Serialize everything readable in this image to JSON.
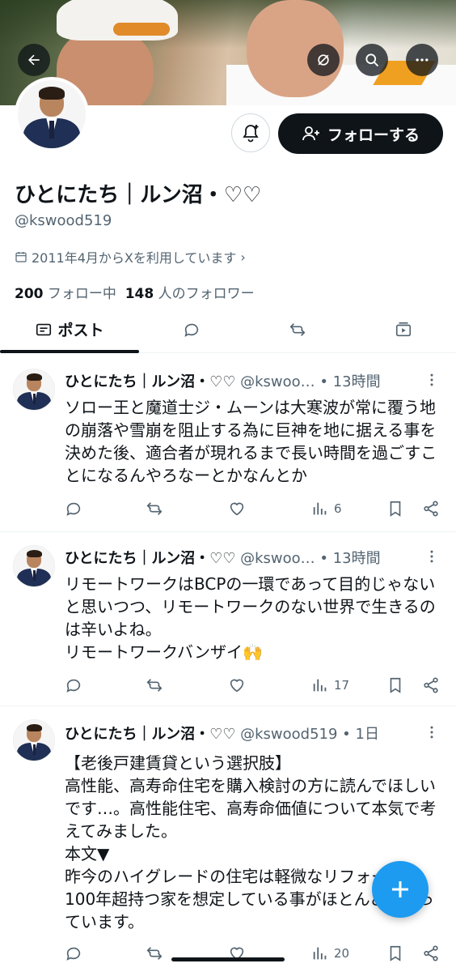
{
  "profile": {
    "name": "ひとにたち｜ルン沼・♡♡",
    "handle": "@kswood519",
    "joined": "2011年4月からXを利用しています",
    "following_count": "200",
    "following_label": "フォロー中",
    "followers_count": "148",
    "followers_label": "人のフォロワー",
    "follow_button": "フォローする"
  },
  "tabs": [
    {
      "label": "ポスト",
      "icon": "posts-icon",
      "active": true
    },
    {
      "label": "",
      "icon": "reply-icon",
      "active": false
    },
    {
      "label": "",
      "icon": "repost-icon",
      "active": false
    },
    {
      "label": "",
      "icon": "media-icon",
      "active": false
    }
  ],
  "posts": [
    {
      "author": "ひとにたち｜ルン沼・♡♡",
      "meta": "@kswoo… • 13時間",
      "text": "ソロー王と魔道士ジ・ムーンは大寒波が常に覆う地の崩落や雪崩を阻止する為に巨神を地に据える事を決めた後、適合者が現れるまで長い時間を過ごすことになるんやろなーとかなんとか",
      "views": "6"
    },
    {
      "author": "ひとにたち｜ルン沼・♡♡",
      "meta": "@kswoo… • 13時間",
      "text": "リモートワークはBCPの一環であって目的じゃないと思いつつ、リモートワークのない世界で生きるのは辛いよね。\nリモートワークバンザイ🙌",
      "views": "17"
    },
    {
      "author": "ひとにたち｜ルン沼・♡♡",
      "meta": "@kswood519 • 1日",
      "text": "【老後戸建賃貸という選択肢】\n高性能、高寿命住宅を購入検討の方に読んでほしいです…。高性能住宅、高寿命価値について本気で考えてみました。\n本文▼\n昨今のハイグレードの住宅は軽微なリフォームで100年超持つ家を想定している事がほとんどになっています。",
      "views": "20"
    }
  ],
  "colors": {
    "accent": "#1d9bf0",
    "text_primary": "#0f1419",
    "text_secondary": "#536471"
  }
}
